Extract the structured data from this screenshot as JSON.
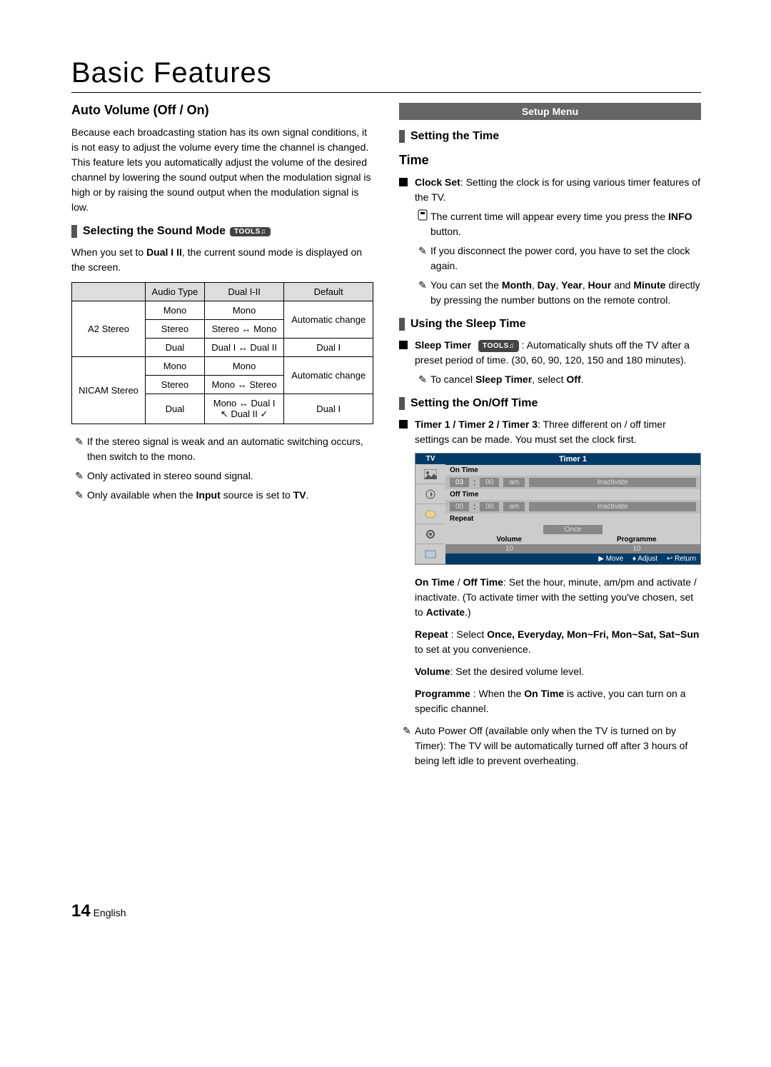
{
  "page": {
    "title": "Basic Features",
    "number": "14",
    "lang": "English"
  },
  "left": {
    "heading": "Auto Volume (Off / On)",
    "intro": "Because each broadcasting station has its own signal conditions, it is not easy to adjust the volume every time the channel is changed. This feature lets you automatically adjust the volume of the desired channel by lowering the sound output when the modulation signal is high or by raising the sound output when the modulation signal is low.",
    "sub1": {
      "title": "Selecting the Sound Mode",
      "badge": "TOOLS♫"
    },
    "sub1_text_a": "When you set to ",
    "sub1_text_bold": "Dual I II",
    "sub1_text_b": ", the current sound mode is displayed on the screen.",
    "table": {
      "headers": {
        "c1": "",
        "c2": "Audio Type",
        "c3": "Dual I-II",
        "c4": "Default"
      },
      "rows": [
        {
          "g": "A2 Stereo",
          "r": [
            {
              "type": "Mono",
              "dual": "Mono",
              "def": "Automatic change"
            },
            {
              "type": "Stereo",
              "dual": "Stereo ↔ Mono",
              "def": ""
            },
            {
              "type": "Dual",
              "dual": "Dual I ↔ Dual II",
              "def": "Dual I"
            }
          ]
        },
        {
          "g": "NICAM Stereo",
          "r": [
            {
              "type": "Mono",
              "dual": "Mono",
              "def": "Automatic change"
            },
            {
              "type": "Stereo",
              "dual": "Mono ↔ Stereo",
              "def": ""
            },
            {
              "type": "Dual",
              "dual": "Mono ↔ Dual I\n↖ Dual II ✓",
              "def": "Dual I"
            }
          ]
        }
      ]
    },
    "notes": [
      "If the stereo signal is weak and an automatic switching occurs, then switch to the mono.",
      "Only activated in stereo sound signal."
    ],
    "note3_a": "Only available when the ",
    "note3_b": "Input",
    "note3_c": " source is set to ",
    "note3_d": "TV",
    "note3_e": "."
  },
  "right": {
    "banner": "Setup Menu",
    "sub1": "Setting the Time",
    "h3": "Time",
    "clockset_label": "Clock Set",
    "clockset_text": ": Setting the clock is for using various timer features of the TV.",
    "cs_note1_a": "The current time will appear every time you press the ",
    "cs_note1_b": "INFO",
    "cs_note1_c": " button.",
    "cs_note2": "If you disconnect the power cord, you have to set the clock again.",
    "cs_note3_a": "You can set the ",
    "cs_note3_b": "Month",
    "cs_note3_c": ", ",
    "cs_note3_d": "Day",
    "cs_note3_e": ", ",
    "cs_note3_f": "Year",
    "cs_note3_g": ", ",
    "cs_note3_h": "Hour",
    "cs_note3_i": " and ",
    "cs_note3_j": "Minute",
    "cs_note3_k": " directly by pressing the number buttons on the remote control.",
    "sub2": "Using the Sleep Time",
    "sleep_label": "Sleep Timer",
    "sleep_badge": "TOOLS♫",
    "sleep_text": " : Automatically shuts off the TV after a preset period of time. (30, 60, 90, 120, 150 and 180 minutes).",
    "sleep_note_a": "To cancel ",
    "sleep_note_b": "Sleep Timer",
    "sleep_note_c": ", select ",
    "sleep_note_d": "Off",
    "sleep_note_e": ".",
    "sub3": "Setting the On/Off Time",
    "timer_label": "Timer 1 / Timer 2 / Timer 3",
    "timer_text": ": Three different on / off timer settings can be made. You must set the clock first.",
    "osd": {
      "side_title": "TV",
      "title": "Timer 1",
      "on_time_label": "On Time",
      "on_hh": "03",
      "on_mm": "00",
      "on_ampm": "am",
      "on_state": "Inactivate",
      "off_time_label": "Off Time",
      "off_hh": "00",
      "off_mm": "00",
      "off_ampm": "am",
      "off_state": "Inactivate",
      "repeat_label": "Repeat",
      "repeat_value": "Once",
      "volume_label": "Volume",
      "volume_value": "10",
      "programme_label": "Programme",
      "programme_value": "10",
      "footer_move": "▶ Move",
      "footer_adjust": "♦ Adjust",
      "footer_return": "↩ Return",
      "colon": ":"
    },
    "para_ontime_a": "On Time",
    "para_ontime_b": " / ",
    "para_ontime_c": "Off Time",
    "para_ontime_d": ": Set the hour, minute, am/pm and activate / inactivate. (To activate timer with the setting you've chosen, set to ",
    "para_ontime_e": "Activate",
    "para_ontime_f": ".)",
    "para_repeat_a": "Repeat",
    "para_repeat_b": " : Select ",
    "para_repeat_c": "Once, Everyday, Mon~Fri, Mon~Sat, Sat~Sun",
    "para_repeat_d": " to set at you convenience.",
    "para_vol_a": "Volume",
    "para_vol_b": ": Set the desired volume level.",
    "para_prog_a": "Programme",
    "para_prog_b": " : When the ",
    "para_prog_c": "On Time",
    "para_prog_d": " is active, you can turn on a specific channel.",
    "auto_off": "Auto Power Off (available only when the TV is turned on by Timer): The TV will be automatically turned off after 3 hours of being left idle to prevent overheating."
  }
}
